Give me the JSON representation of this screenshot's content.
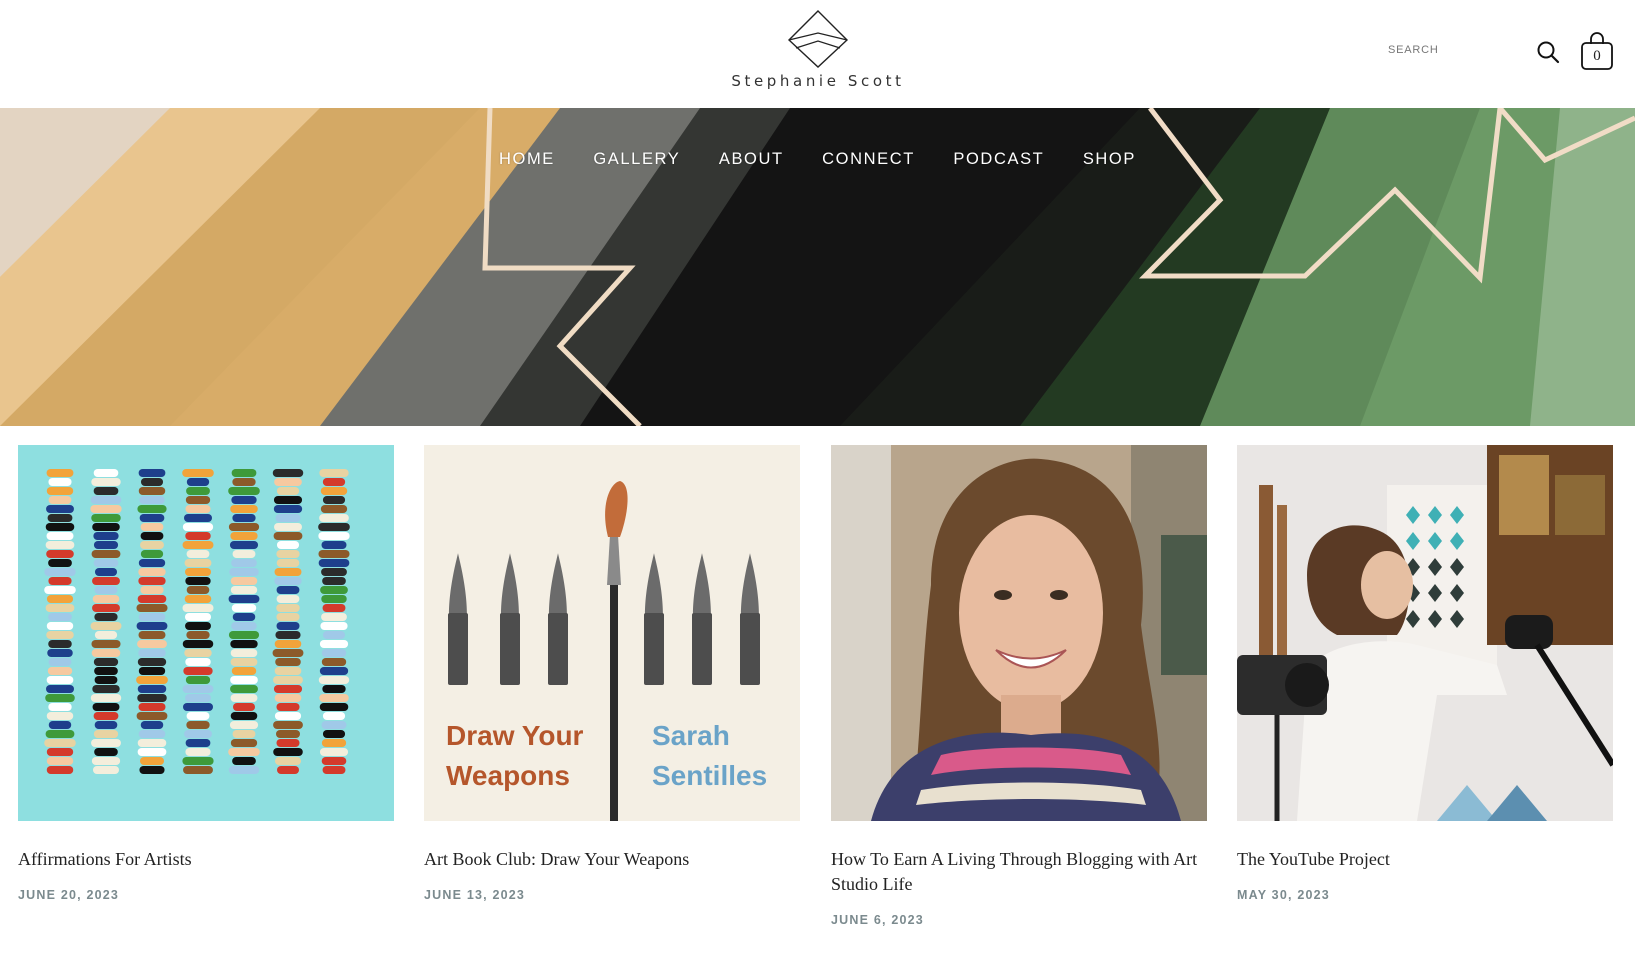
{
  "brand": {
    "name": "Stephanie Scott"
  },
  "header": {
    "search_label": "SEARCH",
    "cart_count": "0"
  },
  "nav": {
    "items": [
      "HOME",
      "GALLERY",
      "ABOUT",
      "CONNECT",
      "PODCAST",
      "SHOP"
    ]
  },
  "posts": [
    {
      "title": "Affirmations For Artists",
      "date": "JUNE 20, 2023",
      "image": "paint-strokes-on-turquoise"
    },
    {
      "title": "Art Book Club: Draw Your Weapons",
      "date": "JUNE 13, 2023",
      "image": "book-cover-bullets-and-brush",
      "cover": {
        "left_text_1": "Draw Your",
        "left_text_2": "Weapons",
        "right_text_1": "Sarah",
        "right_text_2": "Sentilles"
      }
    },
    {
      "title": "How To Earn A Living Through Blogging with Art Studio Life",
      "date": "JUNE 6, 2023",
      "image": "portrait-of-smiling-woman"
    },
    {
      "title": "The YouTube Project",
      "date": "MAY 30, 2023",
      "image": "artist-filming-in-studio"
    }
  ],
  "icons": {
    "search": "search-icon",
    "cart": "shopping-bag-icon",
    "logo": "diamond-logo-icon"
  },
  "colors": {
    "nav_text": "#ffffff",
    "date_text": "#7b8a8e",
    "hero_green": "#5e8a58",
    "hero_tan": "#d6ad6a",
    "hero_black": "#1a1a1a",
    "thumb1_bg": "#8edfe0"
  }
}
